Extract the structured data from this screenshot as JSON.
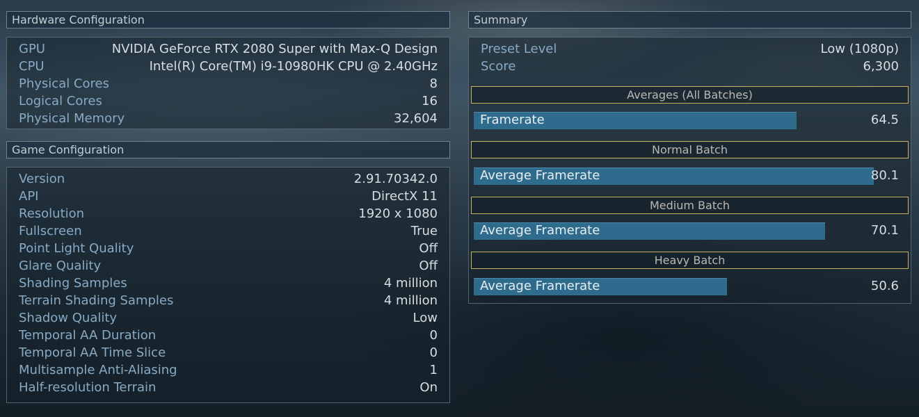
{
  "hardware": {
    "title": "Hardware Configuration",
    "rows": [
      {
        "label": "GPU",
        "value": "NVIDIA GeForce RTX 2080 Super with Max-Q Design"
      },
      {
        "label": "CPU",
        "value": "Intel(R) Core(TM) i9-10980HK CPU @ 2.40GHz"
      },
      {
        "label": "Physical Cores",
        "value": "8"
      },
      {
        "label": "Logical Cores",
        "value": "16"
      },
      {
        "label": "Physical Memory",
        "value": "32,604"
      }
    ]
  },
  "game": {
    "title": "Game Configuration",
    "rows": [
      {
        "label": "Version",
        "value": "2.91.70342.0"
      },
      {
        "label": "API",
        "value": "DirectX 11"
      },
      {
        "label": "Resolution",
        "value": "1920 x 1080"
      },
      {
        "label": "Fullscreen",
        "value": "True"
      },
      {
        "label": "Point Light Quality",
        "value": "Off"
      },
      {
        "label": "Glare Quality",
        "value": "Off"
      },
      {
        "label": "Shading Samples",
        "value": "4 million"
      },
      {
        "label": "Terrain Shading Samples",
        "value": "4 million"
      },
      {
        "label": "Shadow Quality",
        "value": "Low"
      },
      {
        "label": "Temporal AA Duration",
        "value": "0"
      },
      {
        "label": "Temporal AA Time Slice",
        "value": "0"
      },
      {
        "label": "Multisample Anti-Aliasing",
        "value": "1"
      },
      {
        "label": "Half-resolution Terrain",
        "value": "On"
      }
    ]
  },
  "summary": {
    "title": "Summary",
    "rows": [
      {
        "label": "Preset Level",
        "value": "Low (1080p)"
      },
      {
        "label": "Score",
        "value": "6,300"
      }
    ],
    "batches": [
      {
        "title": "Averages (All Batches)",
        "bar_label": "Framerate",
        "value": "64.5",
        "bar_fraction": 0.807
      },
      {
        "title": "Normal Batch",
        "bar_label": "Average Framerate",
        "value": "80.1",
        "bar_fraction": 1.0
      },
      {
        "title": "Medium Batch",
        "bar_label": "Average Framerate",
        "value": "70.1",
        "bar_fraction": 0.878
      },
      {
        "title": "Heavy Batch",
        "bar_label": "Average Framerate",
        "value": "50.6",
        "bar_fraction": 0.633
      }
    ]
  },
  "colors": {
    "label_text": "#88aac4",
    "value_text": "#d8dde0",
    "bar_fill": "#2e6b8d",
    "batch_border": "#c9b160",
    "panel_border": "#6f8290"
  }
}
